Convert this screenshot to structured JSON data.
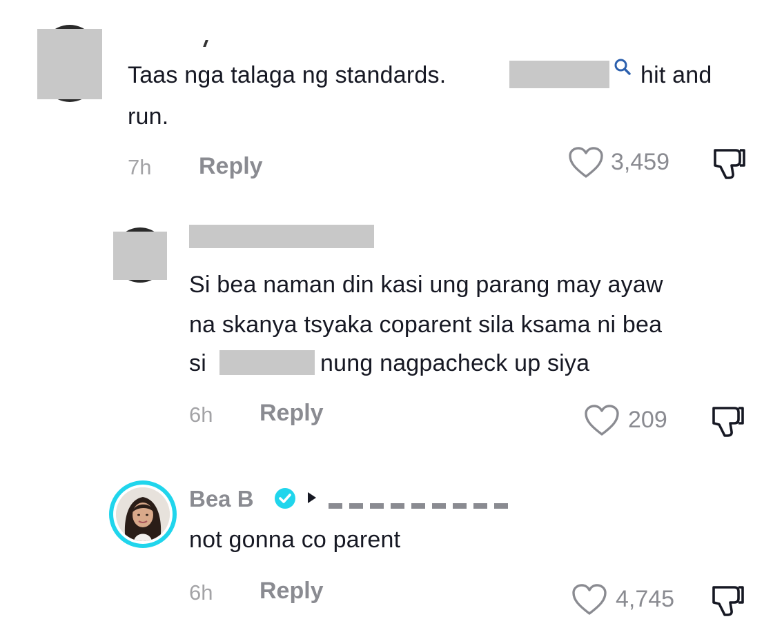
{
  "comments": [
    {
      "text_line1_pre": "Taas nga talaga ng standards.",
      "text_line1_post": "hit and",
      "text_line2": "run.",
      "time": "7h",
      "reply_label": "Reply",
      "likes": "3,459"
    },
    {
      "text_line1": "Si bea naman din kasi ung parang may ayaw",
      "text_line2": "na skanya tsyaka coparent sila ksama ni bea",
      "text_line3_pre": "si",
      "text_line3_post": "nung nagpacheck up siya",
      "time": "6h",
      "reply_label": "Reply",
      "likes": "209"
    },
    {
      "username": "Bea B",
      "text": "not gonna co parent",
      "time": "6h",
      "reply_label": "Reply",
      "likes": "4,745"
    }
  ],
  "colors": {
    "verified": "#20d5ec",
    "avatar_ring": "#20d5ec",
    "search_icon": "#2b5fad",
    "redaction": "#c8c8c8",
    "meta_text": "#8a8b91"
  },
  "icons": [
    "heart-icon",
    "dislike-icon",
    "search-icon",
    "verified-badge-icon",
    "play-arrow-icon"
  ]
}
